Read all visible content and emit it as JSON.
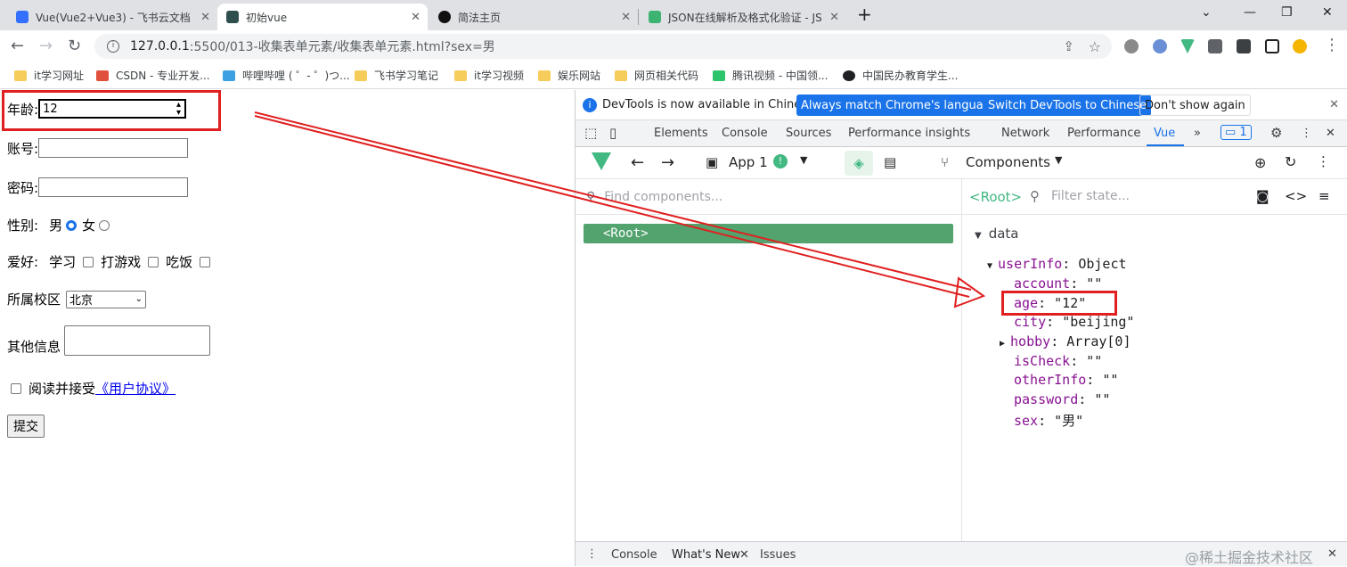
{
  "tabs": [
    {
      "title": "Vue(Vue2+Vue3) - 飞书云文档",
      "favicon_color": "#3370ff"
    },
    {
      "title": "初始vue",
      "favicon_color": "#2f4f4f"
    },
    {
      "title": "简法主页",
      "favicon_color": "#111111"
    },
    {
      "title": "JSON在线解析及格式化验证 - JS",
      "favicon_color": "#3cb371"
    }
  ],
  "new_tab": "+",
  "window_controls": {
    "minimize": "⌄",
    "restore": "—",
    "maximize": "❐",
    "close": "✕"
  },
  "address": {
    "url_host": "127.0.0.1",
    "url_path": ":5500/013-收集表单元素/收集表单元素.html?sex=男"
  },
  "bookmarks": [
    "it学习网址",
    "CSDN - 专业开发...",
    "哔哩哔哩 ( ゜- ゜)つ...",
    "飞书学习笔记",
    "it学习视频",
    "娱乐网站",
    "网页相关代码",
    "腾讯视频 - 中国领...",
    "中国民办教育学生..."
  ],
  "form": {
    "age_label": "年龄:",
    "age_value": "12",
    "account_label": "账号:",
    "password_label": "密码:",
    "gender_label": "性别:",
    "male": "男",
    "female": "女",
    "hobby_label": "爱好:",
    "hobbies": [
      "学习",
      "打游戏",
      "吃饭"
    ],
    "campus_label": "所属校区",
    "campus_value": "北京",
    "other_label": "其他信息",
    "agree_text": "阅读并接受",
    "agree_link": "《用户协议》",
    "submit": "提交"
  },
  "devtools": {
    "info_text": "DevTools is now available in Chinese!",
    "btn_match": "Always match Chrome's language",
    "btn_switch": "Switch DevTools to Chinese",
    "btn_dont": "Don't show again",
    "tabs": [
      "Elements",
      "Console",
      "Sources",
      "Performance insights",
      "Network",
      "Performance",
      "Vue"
    ],
    "badge": "1",
    "app_label": "App 1",
    "components_label": "Components",
    "find_placeholder": "Find components...",
    "root_tree": "<Root>",
    "root_label": "<Root>",
    "filter_placeholder": "Filter state...",
    "section": "data",
    "userInfo_key": "userInfo",
    "userInfo_type": "Object",
    "props": [
      {
        "key": "account",
        "value": "\"\""
      },
      {
        "key": "age",
        "value": "\"12\""
      },
      {
        "key": "city",
        "value": "\"beijing\""
      },
      {
        "key": "hobby",
        "value": "Array[0]"
      },
      {
        "key": "isCheck",
        "value": "\"\""
      },
      {
        "key": "otherInfo",
        "value": "\"\""
      },
      {
        "key": "password",
        "value": "\"\""
      },
      {
        "key": "sex",
        "value": "\"男\""
      }
    ],
    "drawer_tabs": [
      "Console",
      "What's New",
      "Issues"
    ],
    "watermark": "@稀土掘金技术社区"
  },
  "colors": {
    "highlight": "#e02020",
    "vue_green": "#42b883",
    "root_bg": "#52a36e",
    "devtools_blue": "#1a73e8"
  }
}
